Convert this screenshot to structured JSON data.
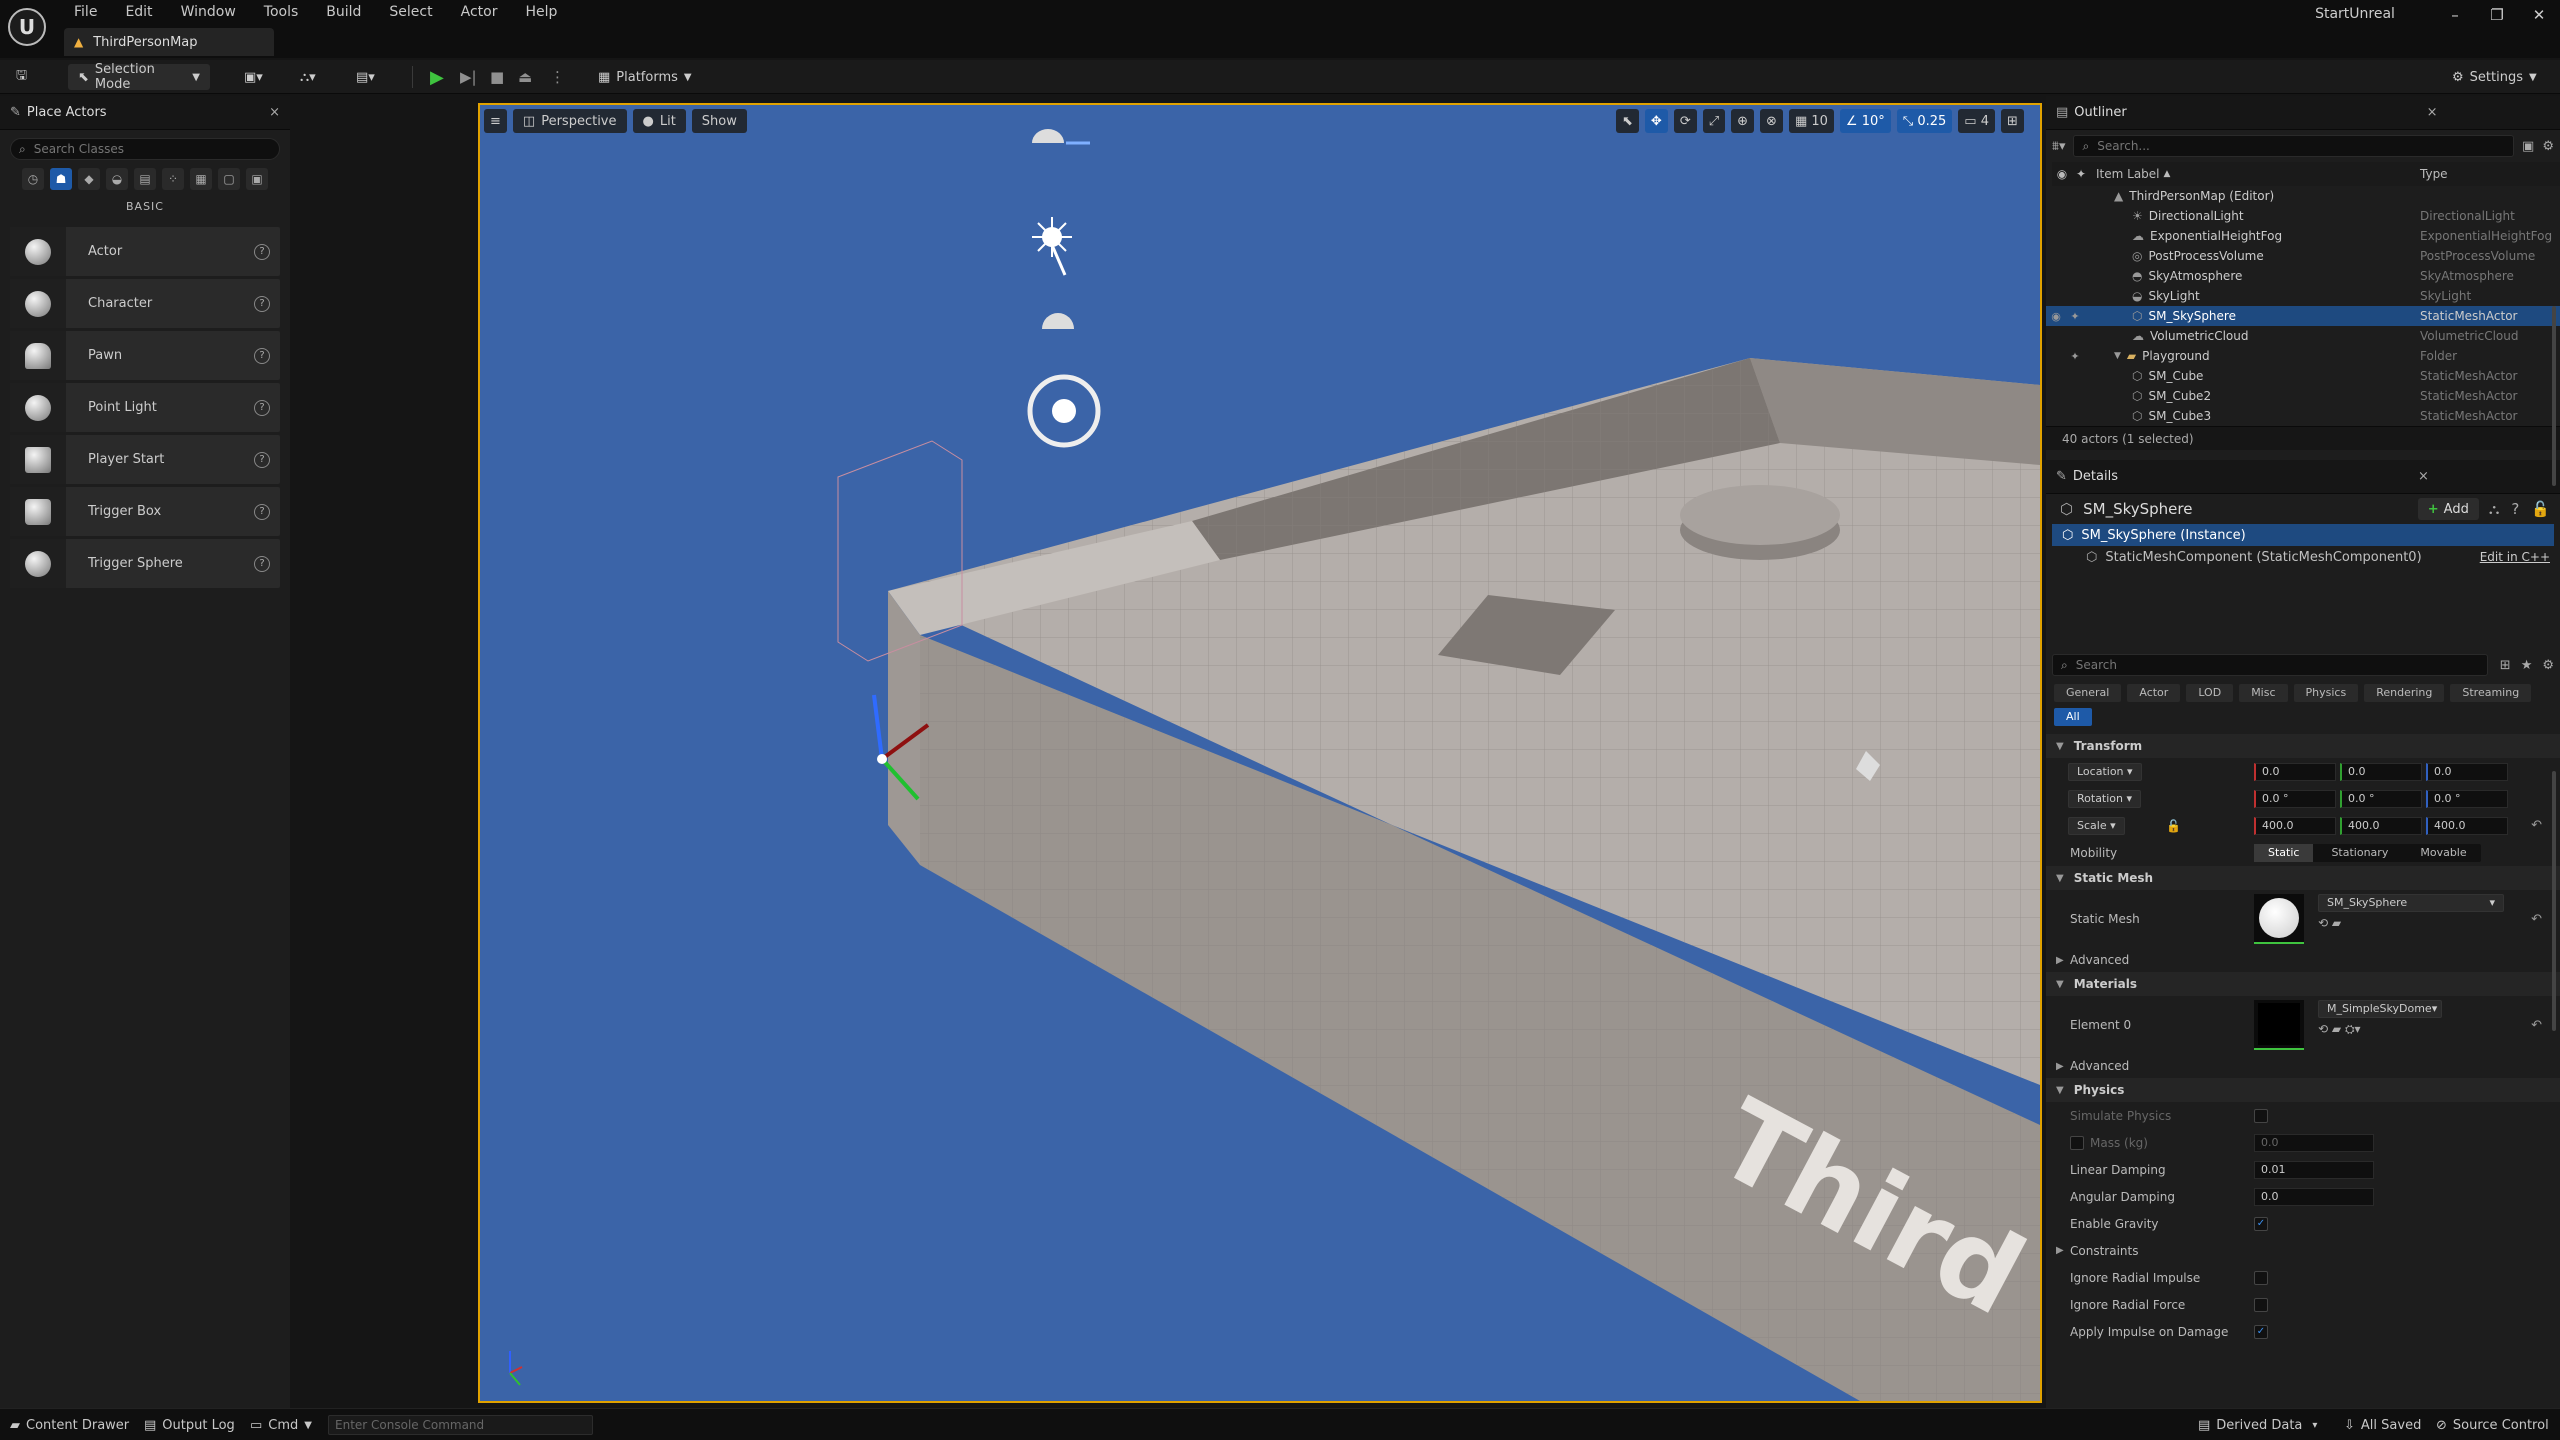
{
  "app": {
    "project_name": "StartUnreal",
    "map_tab": "ThirdPersonMap"
  },
  "menu": [
    "File",
    "Edit",
    "Window",
    "Tools",
    "Build",
    "Select",
    "Actor",
    "Help"
  ],
  "toolbar": {
    "selection_mode": "Selection Mode",
    "platforms": "Platforms",
    "settings": "Settings"
  },
  "place_actors": {
    "tab": "Place Actors",
    "search_placeholder": "Search Classes",
    "category": "BASIC",
    "items": [
      {
        "label": "Actor"
      },
      {
        "label": "Character"
      },
      {
        "label": "Pawn"
      },
      {
        "label": "Point Light"
      },
      {
        "label": "Player Start"
      },
      {
        "label": "Trigger Box"
      },
      {
        "label": "Trigger Sphere"
      }
    ]
  },
  "viewport": {
    "perspective": "Perspective",
    "lit": "Lit",
    "show": "Show",
    "grid": "10",
    "angle": "10°",
    "scale": "0.25",
    "camera_speed": "4",
    "floor_text": "Third"
  },
  "outliner": {
    "tab": "Outliner",
    "search_placeholder": "Search...",
    "col_label": "Item Label",
    "col_type": "Type",
    "root": "ThirdPersonMap (Editor)",
    "rows": [
      {
        "label": "DirectionalLight",
        "type": "DirectionalLight"
      },
      {
        "label": "ExponentialHeightFog",
        "type": "ExponentialHeightFog"
      },
      {
        "label": "PostProcessVolume",
        "type": "PostProcessVolume"
      },
      {
        "label": "SkyAtmosphere",
        "type": "SkyAtmosphere"
      },
      {
        "label": "SkyLight",
        "type": "SkyLight"
      },
      {
        "label": "SM_SkySphere",
        "type": "StaticMeshActor",
        "selected": true
      },
      {
        "label": "VolumetricCloud",
        "type": "VolumetricCloud"
      },
      {
        "label": "Playground",
        "type": "Folder",
        "folder": true
      },
      {
        "label": "SM_Cube",
        "type": "StaticMeshActor"
      },
      {
        "label": "SM_Cube2",
        "type": "StaticMeshActor"
      },
      {
        "label": "SM_Cube3",
        "type": "StaticMeshActor"
      }
    ],
    "count": "40 actors (1 selected)"
  },
  "details": {
    "tab": "Details",
    "actor_name": "SM_SkySphere",
    "add": "Add",
    "instance": "SM_SkySphere (Instance)",
    "component": "StaticMeshComponent (StaticMeshComponent0)",
    "edit_cpp": "Edit in C++",
    "search_placeholder": "Search",
    "filters": [
      "General",
      "Actor",
      "LOD",
      "Misc",
      "Physics",
      "Rendering",
      "Streaming",
      "All"
    ],
    "transform": {
      "title": "Transform",
      "location": {
        "label": "Location",
        "x": "0.0",
        "y": "0.0",
        "z": "0.0"
      },
      "rotation": {
        "label": "Rotation",
        "x": "0.0 °",
        "y": "0.0 °",
        "z": "0.0 °"
      },
      "scale": {
        "label": "Scale",
        "x": "400.0",
        "y": "400.0",
        "z": "400.0"
      },
      "mobility": {
        "label": "Mobility",
        "options": [
          "Static",
          "Stationary",
          "Movable"
        ]
      }
    },
    "static_mesh": {
      "title": "Static Mesh",
      "label": "Static Mesh",
      "value": "SM_SkySphere",
      "advanced": "Advanced"
    },
    "materials": {
      "title": "Materials",
      "element": "Element 0",
      "value": "M_SimpleSkyDome",
      "advanced": "Advanced"
    },
    "physics": {
      "title": "Physics",
      "simulate": "Simulate Physics",
      "mass": "Mass (kg)",
      "mass_value": "0.0",
      "linear_damping": "Linear Damping",
      "linear_value": "0.01",
      "angular_damping": "Angular Damping",
      "angular_value": "0.0",
      "gravity": "Enable Gravity",
      "constraints": "Constraints",
      "radial_impulse": "Ignore Radial Impulse",
      "radial_force": "Ignore Radial Force",
      "impulse_damage": "Apply Impulse on Damage"
    }
  },
  "statusbar": {
    "content_drawer": "Content Drawer",
    "output_log": "Output Log",
    "cmd": "Cmd",
    "console_placeholder": "Enter Console Command",
    "derived_data": "Derived Data",
    "all_saved": "All Saved",
    "source_control": "Source Control"
  },
  "colors": {
    "accent": "#1e5aa8",
    "viewport_border": "#e1a200",
    "sky": "#3b64a8",
    "play": "#3fc33f"
  }
}
